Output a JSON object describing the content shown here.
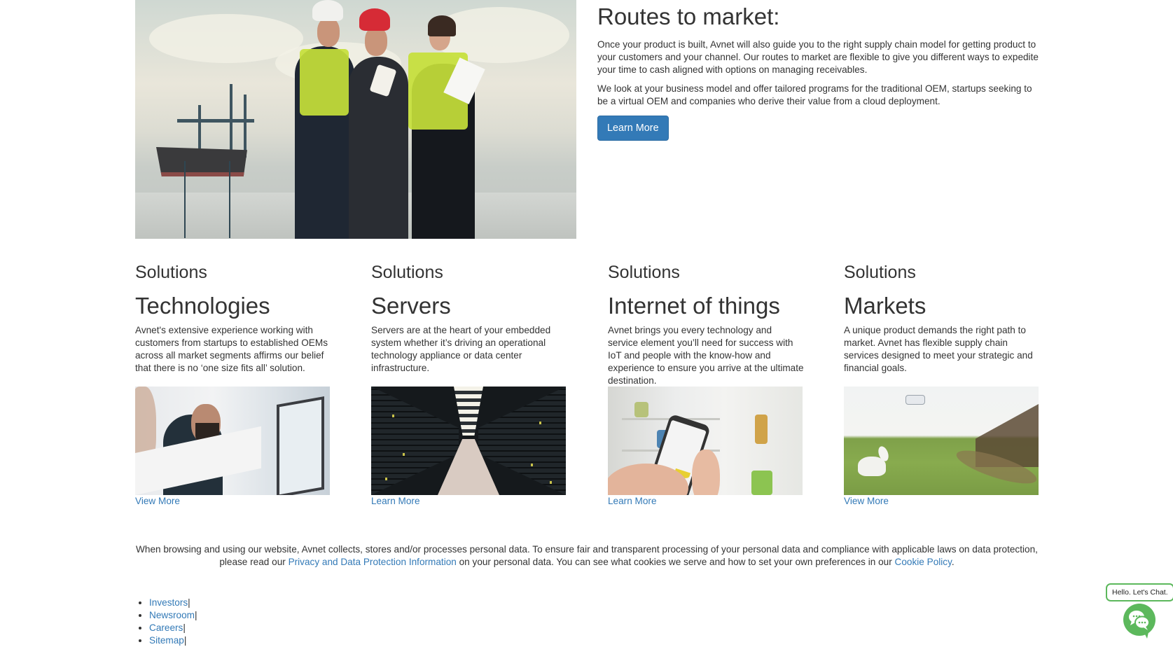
{
  "routes": {
    "title": "Routes to market:",
    "paragraph_1": "Once your product is built, Avnet will also guide you to the right supply chain model for getting product to your customers and your channel. Our routes to market are flexible to give you different ways to expedite your time to cash aligned with options on managing receivables.",
    "paragraph_2": "We look at your business model and offer tailored programs for the traditional OEM, startups seeking to be a virtual OEM and companies who derive their value from a cloud deployment.",
    "button_label": "Learn More",
    "image_alt": "Engineers in hard hats and safety vests reviewing a tablet at a shipping port"
  },
  "solutions": [
    {
      "eyebrow": "Solutions",
      "title": "Technologies",
      "description": "Avnet's extensive experience working with customers from startups to established OEMs across all market segments affirms our belief that there is no ‘one size fits all’ solution.",
      "link_label": "View More",
      "image_alt": "Team members pointing at a chart on a monitor"
    },
    {
      "eyebrow": "Solutions",
      "title": "Servers",
      "description": "Servers are at the heart of your embedded system whether it’s driving an operational technology appliance or data center infrastructure.",
      "link_label": "Learn More",
      "image_alt": "Data center aisle lined with server racks"
    },
    {
      "eyebrow": "Solutions",
      "title": "Internet of things",
      "description": "Avnet brings you every technology and service element you’ll need for success with IoT and people with the know-how and experience to ensure you arrive at the ultimate destination.",
      "link_label": "Learn More",
      "image_alt": "Hand holding smartphone showing a shopping list in front of a refrigerator"
    },
    {
      "eyebrow": "Solutions",
      "title": "Markets",
      "description": "A unique product demands the right path to market. Avnet has flexible supply chain services designed to meet your strategic and financial goals.",
      "link_label": "View More",
      "image_alt": "Dog looking up at a drone over a green field"
    }
  ],
  "cookie_notice": {
    "text_before": "When browsing and using our website, Avnet collects, stores and/or processes personal data. To ensure fair and transparent processing of your personal data and compliance with applicable laws on data protection, please read our ",
    "privacy_link": "Privacy and Data Protection Information",
    "text_middle": " on your personal data. You can see what cookies we serve and how to set your own preferences in our ",
    "cookie_link": "Cookie Policy",
    "text_after": "."
  },
  "footer_links": [
    {
      "label": "Investors",
      "separator": "|"
    },
    {
      "label": "Newsroom",
      "separator": "|"
    },
    {
      "label": "Careers",
      "separator": "|"
    },
    {
      "label": "Sitemap",
      "separator": "|"
    }
  ],
  "chat": {
    "bubble_text": "Hello. Let's Chat.",
    "icon": "chat-bubbles-icon"
  },
  "colors": {
    "link": "#337ab7",
    "primary_button": "#337ab7",
    "chat_green": "#5cb85c",
    "text": "#333333"
  }
}
